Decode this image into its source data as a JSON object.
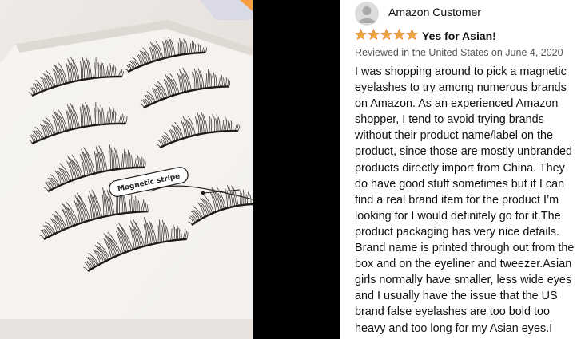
{
  "photo": {
    "annotation_label": "Magnetic stripe",
    "background_color": "#e9e4e0",
    "lash_color": "#1d1a17"
  },
  "review": {
    "customer_name": "Amazon Customer",
    "rating_stars": 5,
    "star_color": "#f3a847",
    "headline": "Yes for Asian!",
    "meta": "Reviewed in the United States on June 4, 2020",
    "body_lines": [
      "I was shopping around to pick a magnetic",
      "eyelashes to try among numerous brands",
      "on Amazon. As an experienced Amazon",
      "shopper, I tend to avoid trying brands",
      "without their product name/label on the",
      "product, since those are mostly unbranded",
      "products directly import from China. They",
      "do have good stuff sometimes but if I can",
      "find a real brand item for the product I’m",
      "looking for I would definitely go for it.The",
      "product packaging has very nice details.",
      "Brand name is printed through out from the",
      "box and on the eyeliner and tweezer.Asian",
      "girls normally have smaller, less wide eyes",
      "and I usually have the issue that the US",
      "brand false eyelashes are too bold too",
      "heavy and too long for my Asian eyes.I went"
    ]
  }
}
